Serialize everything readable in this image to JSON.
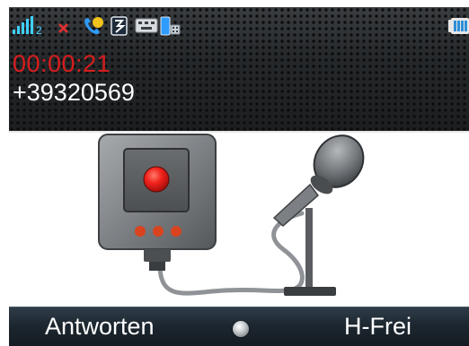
{
  "call": {
    "timer": "00:00:21",
    "number": "+39320569"
  },
  "status_bar": {
    "signal_label": "2",
    "icons": [
      "signal-strength-icon",
      "no-data-icon",
      "call-phone-icon",
      "profile-icon",
      "keypad-icon",
      "sim-icon",
      "battery-icon"
    ]
  },
  "softkeys": {
    "left_label": "Antworten",
    "right_label": "H-Frei"
  },
  "colors": {
    "timer": "#d81d1d",
    "record_button": "#e02020",
    "softkey_bar": "#1d2730"
  }
}
